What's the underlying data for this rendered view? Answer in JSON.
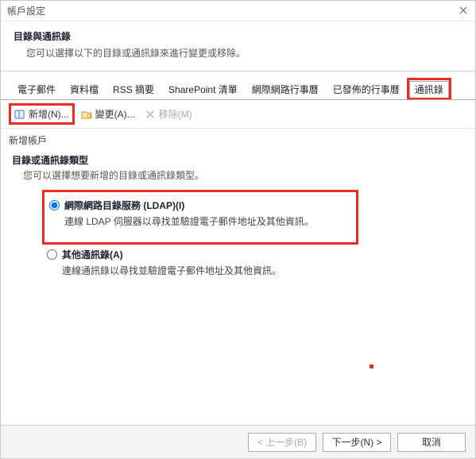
{
  "window": {
    "title": "帳戶設定"
  },
  "header": {
    "title": "目錄與通訊錄",
    "subtitle": "您可以選擇以下的目錄或通訊錄來進行變更或移除。"
  },
  "tabs": [
    {
      "label": "電子郵件"
    },
    {
      "label": "資料檔"
    },
    {
      "label": "RSS 摘要"
    },
    {
      "label": "SharePoint 清單"
    },
    {
      "label": "網際網路行事曆"
    },
    {
      "label": "已發佈的行事曆"
    },
    {
      "label": "通訊錄"
    }
  ],
  "toolbar": {
    "new": "新增(N)...",
    "change": "變更(A)...",
    "remove": "移除(M)"
  },
  "section": {
    "heading": "新增帳戶",
    "type_title": "目錄或通訊錄類型",
    "type_subtitle": "您可以選擇想要新增的目錄或通訊錄類型。"
  },
  "options": {
    "ldap": {
      "label": "網際網路目錄服務 (LDAP)(I)",
      "desc": "連線 LDAP 伺服器以尋找並驗證電子郵件地址及其他資訊。"
    },
    "other": {
      "label": "其他通訊錄(A)",
      "desc": "連線通訊錄以尋找並驗證電子郵件地址及其他資訊。"
    }
  },
  "footer": {
    "back": "< 上一步(B)",
    "next": "下一步(N) >",
    "cancel": "取消"
  }
}
